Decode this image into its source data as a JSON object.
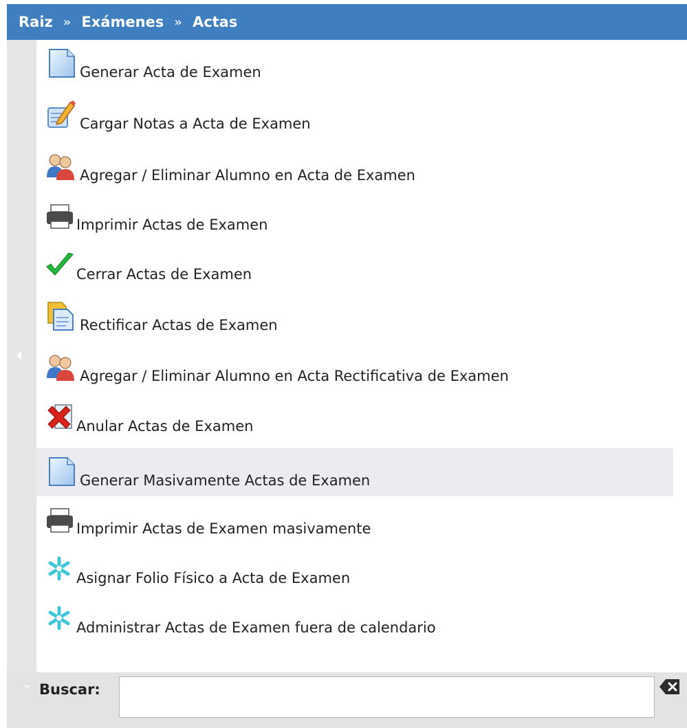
{
  "breadcrumb": [
    {
      "label": "Raiz"
    },
    {
      "label": "Exámenes"
    },
    {
      "label": "Actas"
    }
  ],
  "breadcrumb_separator": "»",
  "menu_items": [
    {
      "label": "Generar Acta de Examen",
      "icon": "document-icon"
    },
    {
      "label": "Cargar Notas a Acta de Examen",
      "icon": "edit-notes-icon"
    },
    {
      "label": "Agregar / Eliminar Alumno en Acta de Examen",
      "icon": "users-icon"
    },
    {
      "label": "Imprimir Actas de Examen",
      "icon": "printer-icon"
    },
    {
      "label": "Cerrar Actas de Examen",
      "icon": "checkmark-icon"
    },
    {
      "label": "Rectificar Actas de Examen",
      "icon": "copy-document-icon"
    },
    {
      "label": "Agregar / Eliminar Alumno en Acta Rectificativa de Examen",
      "icon": "users-icon"
    },
    {
      "label": "Anular Actas de Examen",
      "icon": "cancel-icon"
    },
    {
      "label": "Generar Masivamente Actas de Examen",
      "icon": "document-icon",
      "highlighted": true
    },
    {
      "label": "Imprimir Actas de Examen masivamente",
      "icon": "printer-icon"
    },
    {
      "label": "Asignar Folio Físico a Acta de Examen",
      "icon": "asterisk-icon"
    },
    {
      "label": "Administrar Actas de Examen fuera de calendario",
      "icon": "asterisk-icon"
    }
  ],
  "search": {
    "label": "Buscar:",
    "value": "",
    "placeholder": ""
  },
  "colors": {
    "header_bg": "#3f7fbf",
    "highlight_row": "#ebebf0"
  }
}
